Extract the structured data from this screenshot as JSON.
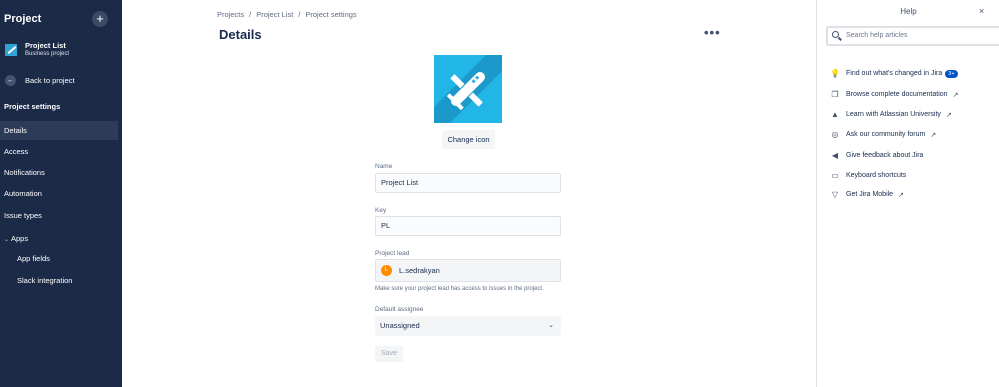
{
  "sidebar": {
    "header": "Project",
    "add_label": "+",
    "project": {
      "name": "Project List",
      "type": "Business project"
    },
    "back_label": "Back to project",
    "section_title": "Project settings",
    "items": [
      {
        "label": "Details"
      },
      {
        "label": "Access"
      },
      {
        "label": "Notifications"
      },
      {
        "label": "Automation"
      },
      {
        "label": "Issue types"
      },
      {
        "label": "Apps"
      },
      {
        "label": "App fields"
      },
      {
        "label": "Slack integration"
      }
    ]
  },
  "breadcrumb": [
    "Projects",
    "Project List",
    "Project settings"
  ],
  "breadcrumb_sep": "/",
  "page_title": "Details",
  "more_label": "•••",
  "change_icon_label": "Change icon",
  "form": {
    "name_label": "Name",
    "name_value": "Project List",
    "key_label": "Key",
    "key_value": "PL",
    "lead_label": "Project lead",
    "lead_value": "L.sedrakyan",
    "lead_initial": "L",
    "lead_hint": "Make sure your project lead has access to issues in the project.",
    "assignee_label": "Default assignee",
    "assignee_value": "Unassigned",
    "save_label": "Save"
  },
  "help": {
    "title": "Help",
    "close": "×",
    "search_placeholder": "Search help articles",
    "items": [
      {
        "label": "Find out what's changed in Jira",
        "icon": "lightbulb-icon",
        "badge": "3+"
      },
      {
        "label": "Browse complete documentation",
        "icon": "document-icon",
        "external": true
      },
      {
        "label": "Learn with Atlassian University",
        "icon": "atlassian-icon",
        "external": true
      },
      {
        "label": "Ask our community forum",
        "icon": "chat-icon",
        "external": true
      },
      {
        "label": "Give feedback about Jira",
        "icon": "megaphone-icon"
      },
      {
        "label": "Keyboard shortcuts",
        "icon": "keyboard-icon"
      },
      {
        "label": "Get Jira Mobile",
        "icon": "mobile-icon",
        "external": true
      }
    ]
  },
  "colors": {
    "sidebar_bg": "#1b2a47",
    "accent": "#0052cc",
    "icon_bg": "#21b6e6",
    "avatar": "#ff8b00"
  }
}
